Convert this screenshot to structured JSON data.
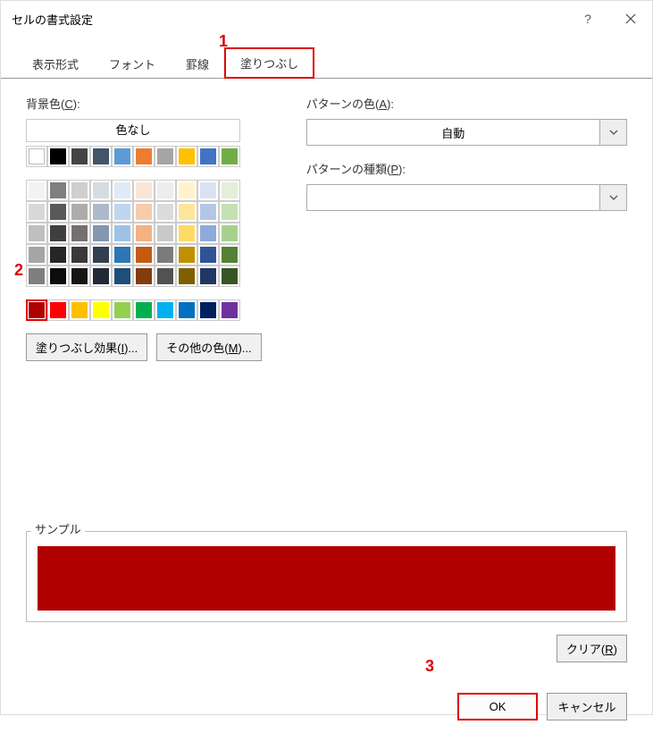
{
  "title": "セルの書式設定",
  "tabs": {
    "t0": "表示形式",
    "t1": "フォント",
    "t2": "罫線",
    "t3": "塗りつぶし"
  },
  "left": {
    "label": "背景色(C):",
    "label_underline": "C",
    "no_color": "色なし",
    "btn_fill_effects": "塗りつぶし効果(I)...",
    "btn_more_colors": "その他の色(M)..."
  },
  "right": {
    "pattern_color_label": "パターンの色(A):",
    "pattern_color_value": "自動",
    "pattern_type_label": "パターンの種類(P):",
    "pattern_type_value": ""
  },
  "sample_label": "サンプル",
  "sample_color": "#b00000",
  "clear_label": "クリア(R)",
  "ok_label": "OK",
  "cancel_label": "キャンセル",
  "annotation_1": "1",
  "annotation_2": "2",
  "annotation_3": "3",
  "palette_row1": [
    "#ffffff",
    "#000000",
    "#444444",
    "#44546a",
    "#5b9bd5",
    "#ed7d31",
    "#a5a5a5",
    "#ffc000",
    "#4472c4",
    "#70ad47"
  ],
  "palette_block": [
    [
      "#f2f2f2",
      "#7f7f7f",
      "#d0cece",
      "#d6dce4",
      "#deebf6",
      "#fbe5d5",
      "#ededed",
      "#fff2cc",
      "#d9e2f3",
      "#e2efd9"
    ],
    [
      "#d8d8d8",
      "#595959",
      "#aeabab",
      "#adb9ca",
      "#bdd7ee",
      "#f7cbac",
      "#dbdbdb",
      "#fee599",
      "#b4c6e7",
      "#c5e0b3"
    ],
    [
      "#bfbfbf",
      "#3f3f3f",
      "#757070",
      "#8496b0",
      "#9cc3e5",
      "#f4b183",
      "#c9c9c9",
      "#ffd965",
      "#8eaadb",
      "#a8d08d"
    ],
    [
      "#a5a5a5",
      "#262626",
      "#3a3838",
      "#323f4f",
      "#2e75b5",
      "#c55a11",
      "#7b7b7b",
      "#bf9000",
      "#2f5496",
      "#538135"
    ],
    [
      "#7f7f7f",
      "#0c0c0c",
      "#171616",
      "#222a35",
      "#1e4e79",
      "#833c0b",
      "#525252",
      "#7f6000",
      "#1f3864",
      "#375623"
    ]
  ],
  "palette_standard": [
    "#b00000",
    "#ff0000",
    "#ffc000",
    "#ffff00",
    "#92d050",
    "#00b050",
    "#00b0f0",
    "#0070c0",
    "#002060",
    "#7030a0"
  ]
}
